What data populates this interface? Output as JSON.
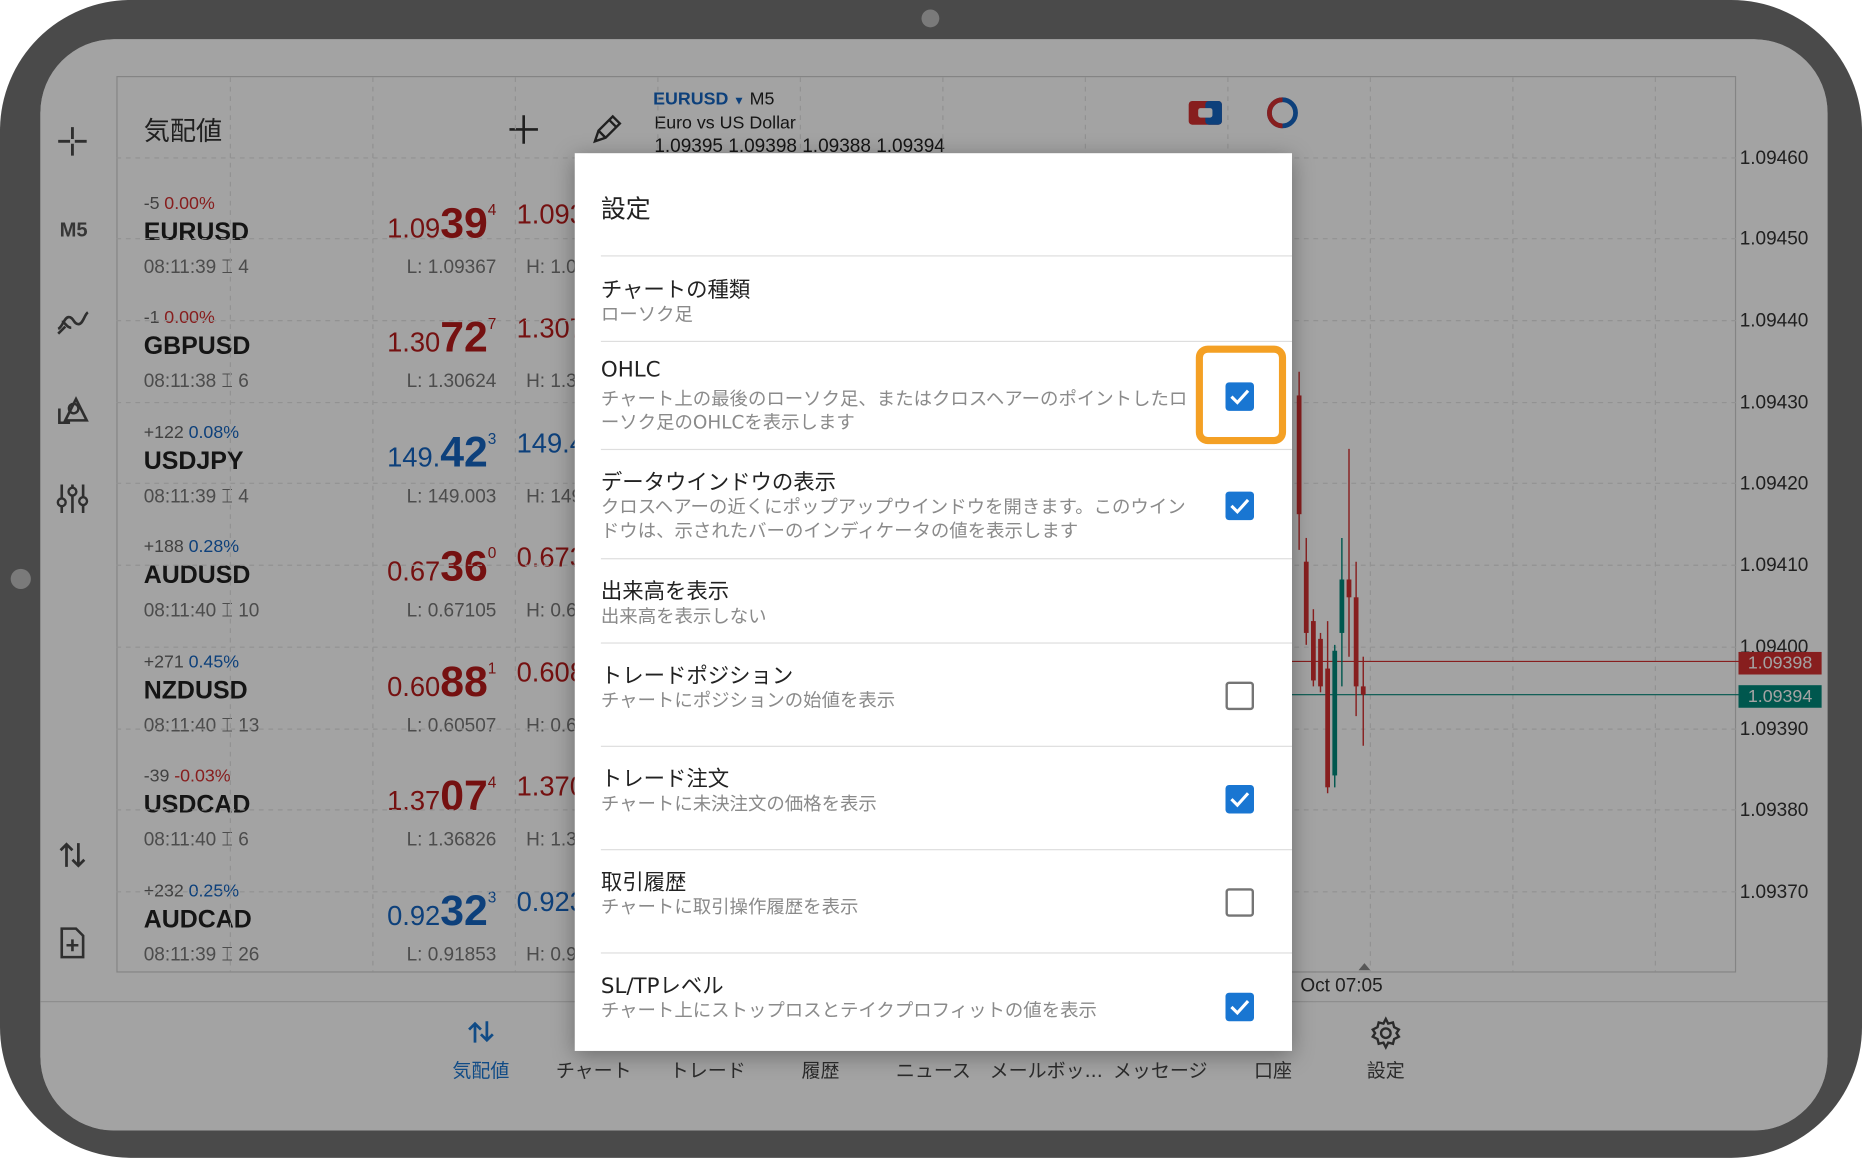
{
  "colors": {
    "bid_red": "#b71c1c",
    "bid_blue": "#1565c0",
    "accent": "#1976d2",
    "highlight": "#f4a024",
    "bear": "#d32f2f",
    "bull": "#00897b"
  },
  "left_toolbar": {
    "timeframe": "M5",
    "icons": [
      "crosshair-icon",
      "indicator-icon",
      "objects-icon",
      "settings-sliders-icon",
      "trade-arrows-icon",
      "new-document-icon"
    ]
  },
  "quotes": {
    "title": "気配値",
    "rows": [
      {
        "change": "-5",
        "pct": "0.00%",
        "symbol": "EURUSD",
        "time": "08:11:39 ⌶ 4",
        "bid_pre": "1.09",
        "bid_big": "39",
        "bid_sup": "4",
        "ask": "1.093",
        "low": "L: 1.09367",
        "high": "H: 1.0",
        "color": "red"
      },
      {
        "change": "-1",
        "pct": "0.00%",
        "symbol": "GBPUSD",
        "time": "08:11:38 ⌶ 6",
        "bid_pre": "1.30",
        "bid_big": "72",
        "bid_sup": "7",
        "ask": "1.307",
        "low": "L: 1.30624",
        "high": "H: 1.3",
        "color": "red"
      },
      {
        "change": "+122",
        "pct": "0.08%",
        "symbol": "USDJPY",
        "time": "08:11:39 ⌶ 4",
        "bid_pre": "149.",
        "bid_big": "42",
        "bid_sup": "3",
        "ask": "149.4",
        "low": "L: 149.003",
        "high": "H: 149",
        "color": "blue"
      },
      {
        "change": "+188",
        "pct": "0.28%",
        "symbol": "AUDUSD",
        "time": "08:11:40 ⌶ 10",
        "bid_pre": "0.67",
        "bid_big": "36",
        "bid_sup": "0",
        "ask": "0.673",
        "low": "L: 0.67105",
        "high": "H: 0.6",
        "color": "red"
      },
      {
        "change": "+271",
        "pct": "0.45%",
        "symbol": "NZDUSD",
        "time": "08:11:40 ⌶ 13",
        "bid_pre": "0.60",
        "bid_big": "88",
        "bid_sup": "1",
        "ask": "0.608",
        "low": "L: 0.60507",
        "high": "H: 0.6",
        "color": "red"
      },
      {
        "change": "-39",
        "pct": "-0.03%",
        "symbol": "USDCAD",
        "time": "08:11:40 ⌶ 6",
        "bid_pre": "1.37",
        "bid_big": "07",
        "bid_sup": "4",
        "ask": "1.370",
        "low": "L: 1.36826",
        "high": "H: 1.3",
        "color": "red"
      },
      {
        "change": "+232",
        "pct": "0.25%",
        "symbol": "AUDCAD",
        "time": "08:11:39 ⌶ 26",
        "bid_pre": "0.92",
        "bid_big": "32",
        "bid_sup": "3",
        "ask": "0.923",
        "low": "L: 0.91853",
        "high": "H: 0.9",
        "color": "blue"
      }
    ]
  },
  "chart": {
    "symbol": "EURUSD",
    "timeframe": "M5",
    "description": "Euro vs US Dollar",
    "ohlc": "1.09395 1.09398 1.09388 1.09394",
    "price_labels": [
      "1.09460",
      "1.09450",
      "1.09440",
      "1.09430",
      "1.09420",
      "1.09410",
      "1.09400",
      "1.09390",
      "1.09380",
      "1.09370"
    ],
    "bid_tag": "1.09398",
    "ask_tag": "1.09394",
    "time_label": "Oct 07:05"
  },
  "bottom_nav": [
    {
      "label": "気配値",
      "icon": "quotes-arrows-icon"
    },
    {
      "label": "チャート",
      "icon": "chart-icon"
    },
    {
      "label": "トレード",
      "icon": "trade-icon"
    },
    {
      "label": "履歴",
      "icon": "history-icon"
    },
    {
      "label": "ニュース",
      "icon": "news-icon"
    },
    {
      "label": "メールボッ...",
      "icon": "mailbox-icon"
    },
    {
      "label": "メッセージ",
      "icon": "messages-icon"
    },
    {
      "label": "口座",
      "icon": "account-icon"
    },
    {
      "label": "設定",
      "icon": "gear-icon"
    }
  ],
  "settings_dialog": {
    "title": "設定",
    "items": [
      {
        "label": "チャートの種類",
        "desc": "ローソク足"
      },
      {
        "label": "OHLC",
        "desc": "チャート上の最後のローソク足、またはクロスヘアーのポイントしたローソク足のOHLCを表示します",
        "checked": true
      },
      {
        "label": "データウインドウの表示",
        "desc": "クロスヘアーの近くにポップアップウインドウを開きます。このウインドウは、示されたバーのインディケータの値を表示します",
        "checked": true
      },
      {
        "label": "出来高を表示",
        "desc": "出来高を表示しない"
      },
      {
        "label": "トレードポジション",
        "desc": "チャートにポジションの始値を表示",
        "checked": false
      },
      {
        "label": "トレード注文",
        "desc": "チャートに未決注文の価格を表示",
        "checked": true
      },
      {
        "label": "取引履歴",
        "desc": "チャートに取引操作履歴を表示",
        "checked": false
      },
      {
        "label": "SL/TPレベル",
        "desc": "チャート上にストップロスとテイクプロフィットの値を表示",
        "checked": true
      }
    ]
  }
}
